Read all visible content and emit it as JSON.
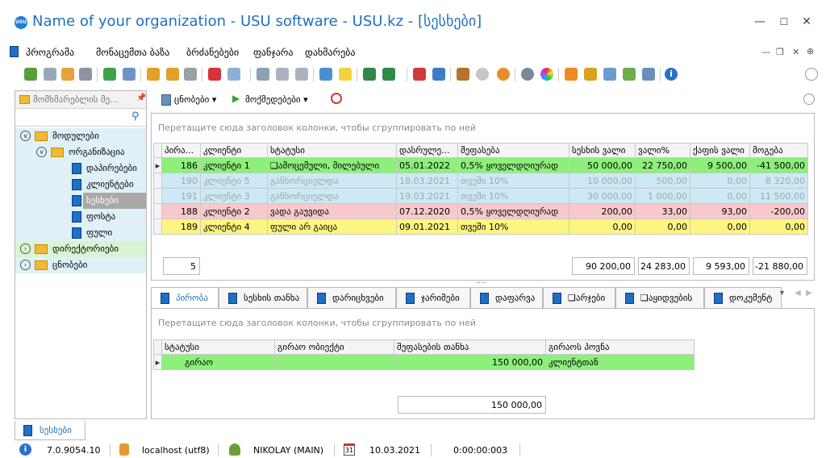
{
  "window": {
    "title": "Name of your organization - USU software - USU.kz - [სესხები]",
    "logo_text": "USU"
  },
  "menu": {
    "items": [
      "პროგრამა",
      "მონაცემთა ბაზა",
      "ბრძანებები",
      "ფანჯარა",
      "დახმარება"
    ]
  },
  "left_panel": {
    "header": "მომხმარებლის მე...",
    "tree": [
      {
        "label": "მოდულები",
        "level": 0,
        "expand": "collapse",
        "icon": "folder-icon"
      },
      {
        "label": "ორგანიზაცია",
        "level": 1,
        "expand": "collapse",
        "icon": "folder-icon"
      },
      {
        "label": "დაპირებები",
        "level": 2,
        "icon": "book-icon"
      },
      {
        "label": "კლიენტები",
        "level": 2,
        "icon": "book-icon"
      },
      {
        "label": "სესხები",
        "level": 2,
        "icon": "book-icon",
        "selected": true
      },
      {
        "label": "ფოსტა",
        "level": 2,
        "icon": "book-icon"
      },
      {
        "label": "ფული",
        "level": 2,
        "icon": "book-icon"
      },
      {
        "label": "დირექტორიები",
        "level": 0,
        "expand": "expand",
        "icon": "folder-icon"
      },
      {
        "label": "ცნობები",
        "level": 0,
        "expand": "expand",
        "icon": "folder-icon"
      }
    ]
  },
  "content_toolbar": {
    "reports_label": "ცნობები",
    "actions_label": "მოქმედებები"
  },
  "main_grid": {
    "group_hint": "Перетащите сюда заголовок колонки, чтобы сгруппировать по ней",
    "columns": [
      "პირა...",
      "კლიენტი",
      "სტატუსი",
      "დასრულე...",
      "შეფასება",
      "სესხის ვალი",
      "ვალი%",
      "ქაფის ვალი",
      "მოგება"
    ],
    "rows": [
      {
        "style": "green",
        "cells": [
          "186",
          "კლიენტი 1",
          "❑ამოცემული, მილებული",
          "05.01.2022",
          "0,5% ყოველდღიურად",
          "50 000,00",
          "22 750,00",
          "9 500,00",
          "-41 500,00"
        ],
        "current": true
      },
      {
        "style": "grey",
        "cells": [
          "190",
          "კლიენტი 5",
          "განსორციელდა",
          "18.03.2021",
          "თვეში 10%",
          "10 000,00",
          "500,00",
          "0,00",
          "8 320,00"
        ]
      },
      {
        "style": "grey",
        "cells": [
          "191",
          "კლიენტი 3",
          "განსორციელდა",
          "19.03.2021",
          "თვეში 10%",
          "30 000,00",
          "1 000,00",
          "0,00",
          "11 500,00"
        ]
      },
      {
        "style": "pink",
        "cells": [
          "188",
          "კლიენტი 2",
          "ვადა გაუვიდა",
          "07.12.2020",
          "0,5% ყოველდღიურად",
          "200,00",
          "33,00",
          "93,00",
          "-200,00"
        ]
      },
      {
        "style": "yellow",
        "cells": [
          "189",
          "კლიენტი 4",
          "ფული არ გაიცა",
          "09.01.2021",
          "თვეში 10%",
          "0,00",
          "0,00",
          "0,00",
          "0,00"
        ]
      }
    ],
    "footer": {
      "count": "5",
      "sum_loan": "90 200,00",
      "sum_debt_pct": "24 283,00",
      "sum_fee": "9 593,00",
      "sum_profit": "-21 880,00"
    }
  },
  "detail_tabs": [
    "პირობა",
    "სესხის თანხა",
    "დარიცხვები",
    "ჯარიმები",
    "დაფარვა",
    "❑არჯები",
    "❑აყიდვების",
    "დოკუმენტ"
  ],
  "detail_grid": {
    "group_hint": "Перетащите сюда заголовок колонки, чтобы сгруппировать по ней",
    "columns": [
      "სტატუსი",
      "გირაო ობიექტი",
      "შეფასების თანხა",
      "გირაოს პოვნა"
    ],
    "rows": [
      {
        "style": "green",
        "cells": [
          "გირაო",
          "",
          "150 000,00",
          "კლიენტთან"
        ]
      }
    ],
    "footer_sum": "150 000,00"
  },
  "bottom_tab": {
    "label": "სესხები"
  },
  "status_bar": {
    "version": "7.0.9054.10",
    "database": "localhost (utf8)",
    "user": "NIKOLAY (MAIN)",
    "date": "10.03.2021",
    "timer": "0:00:00:003"
  },
  "colors": {
    "accent": "#1f6fc4",
    "row_green": "#8cf07a",
    "row_grey": "#cde9f5",
    "row_pink": "#f7c9cb",
    "row_yellow": "#fdf582"
  }
}
